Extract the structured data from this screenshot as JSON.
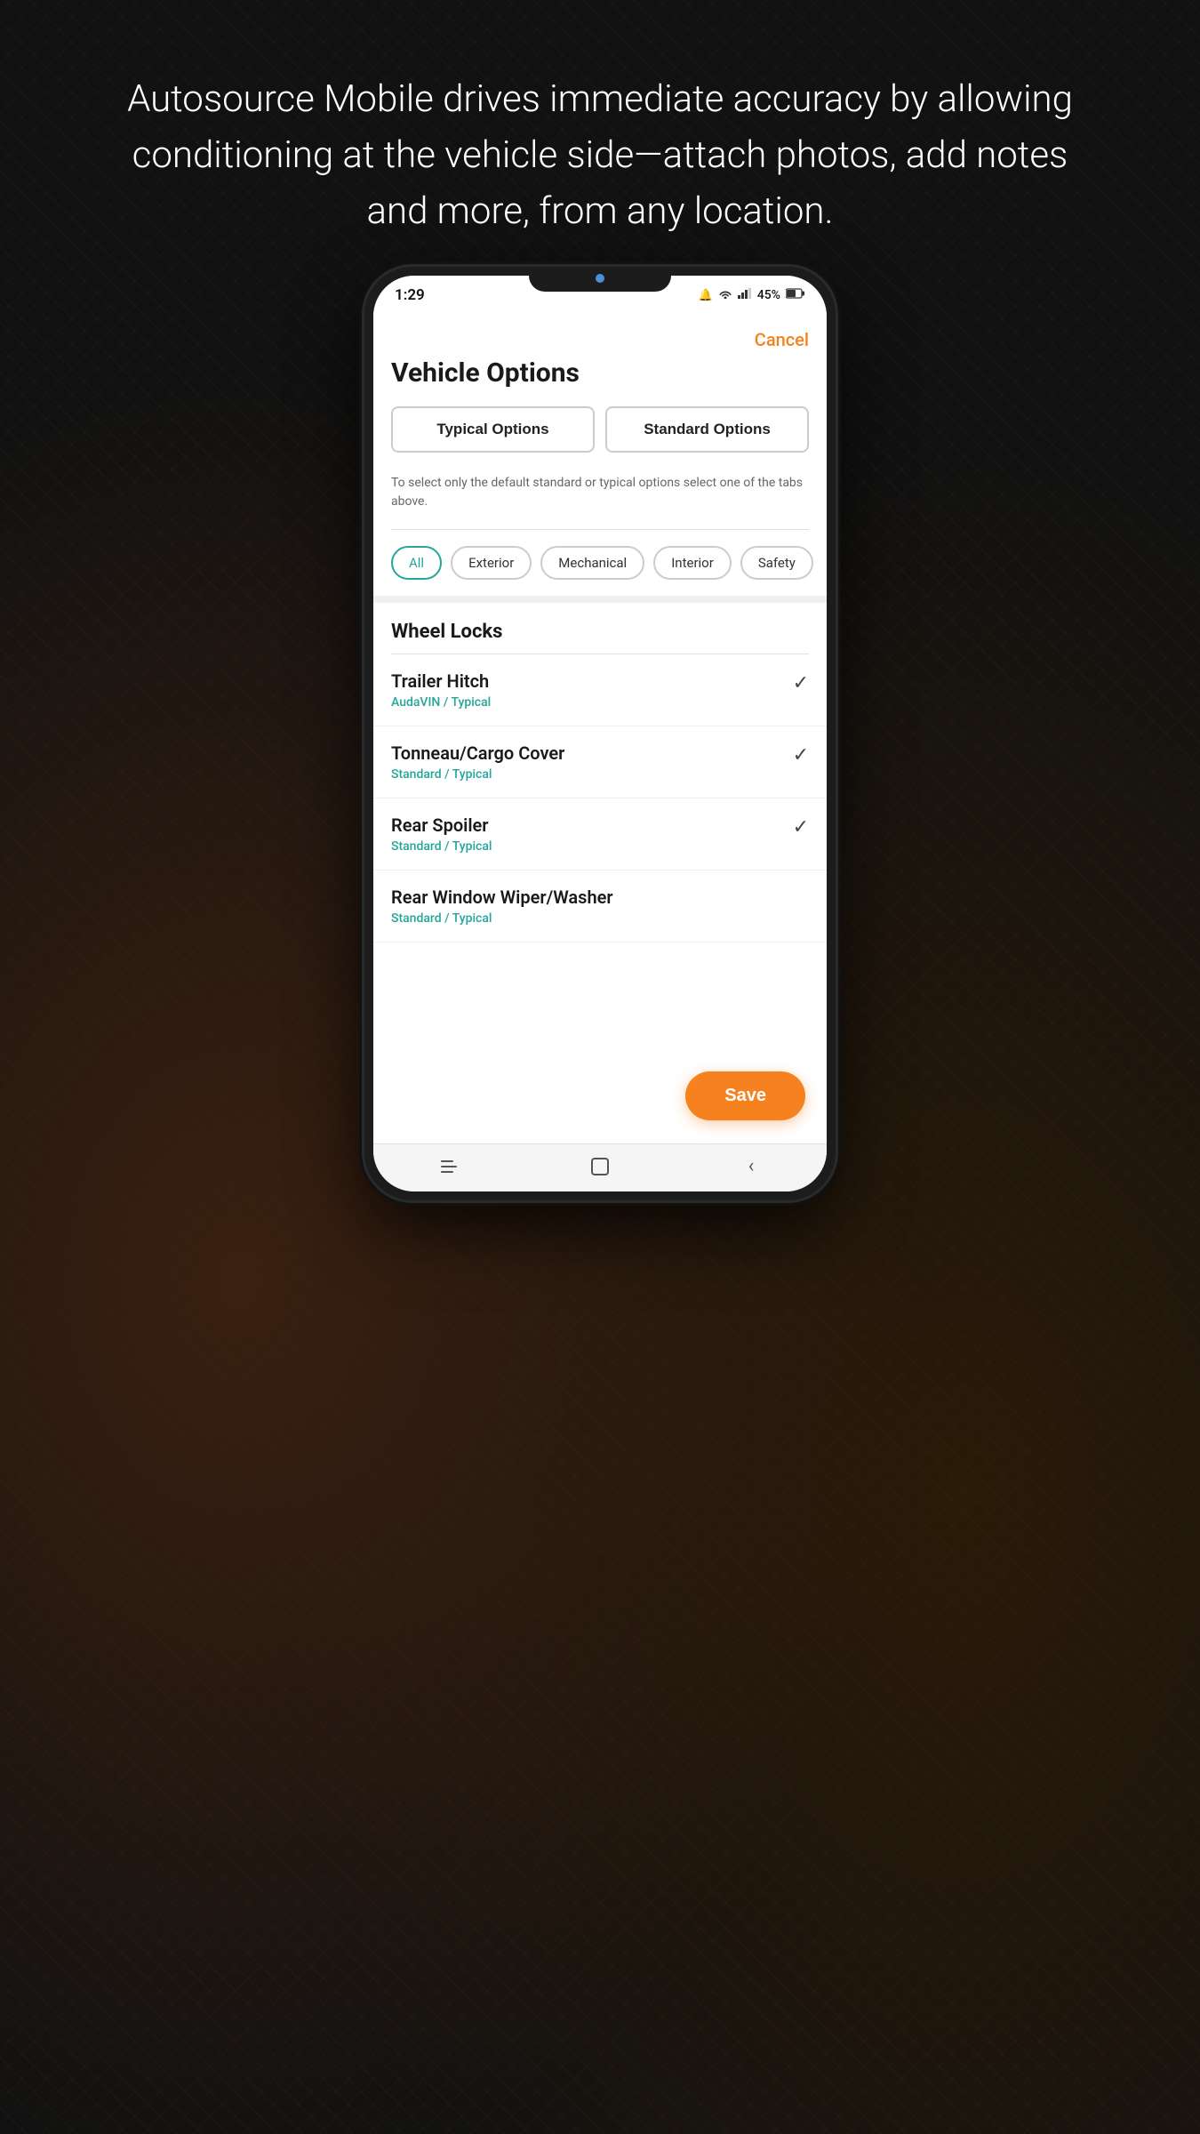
{
  "background": {
    "headline": "Autosource Mobile drives immediate accuracy by allowing conditioning at the vehicle side—attach photos, add notes and more, from any location."
  },
  "status_bar": {
    "time": "1:29",
    "battery": "45%",
    "signal": "●●●",
    "wifi": "WiFi"
  },
  "modal": {
    "cancel_label": "Cancel",
    "title": "Vehicle Options",
    "tabs": [
      {
        "id": "typical",
        "label": "Typical Options"
      },
      {
        "id": "standard",
        "label": "Standard Options"
      }
    ],
    "hint": "To select only the default standard or typical options select one of the tabs above.",
    "filters": [
      {
        "id": "all",
        "label": "All",
        "active": true
      },
      {
        "id": "exterior",
        "label": "Exterior",
        "active": false
      },
      {
        "id": "mechanical",
        "label": "Mechanical",
        "active": false
      },
      {
        "id": "interior",
        "label": "Interior",
        "active": false
      },
      {
        "id": "safety",
        "label": "Safety",
        "active": false
      }
    ],
    "section_header": "Wheel Locks",
    "items": [
      {
        "title": "Trailer Hitch",
        "subtitle": "AudaVIN / Typical",
        "checked": true
      },
      {
        "title": "Tonneau/Cargo Cover",
        "subtitle": "Standard / Typical",
        "checked": true
      },
      {
        "title": "Rear Spoiler",
        "subtitle": "Standard / Typical",
        "checked": true
      },
      {
        "title": "Rear Window Wiper/Washer",
        "subtitle": "Standard / Typical",
        "checked": false
      }
    ],
    "save_label": "Save"
  },
  "nav": {
    "back_icon": "‹",
    "home_icon": "□",
    "menu_icon": "≡"
  }
}
